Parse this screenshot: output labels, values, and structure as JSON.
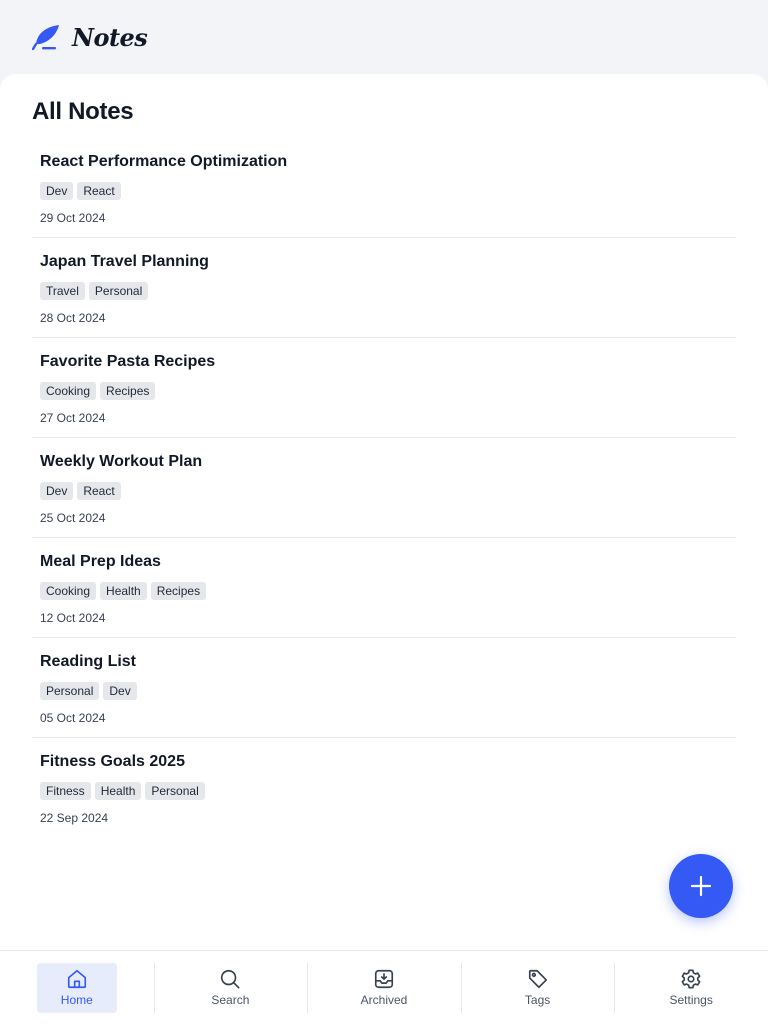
{
  "app": {
    "name": "Notes",
    "logo_icon": "feather-pen-icon",
    "accent_color": "#3559f5"
  },
  "main": {
    "title": "All Notes",
    "notes": [
      {
        "title": "React Performance Optimization",
        "tags": [
          "Dev",
          "React"
        ],
        "date": "29 Oct 2024"
      },
      {
        "title": "Japan Travel Planning",
        "tags": [
          "Travel",
          "Personal"
        ],
        "date": "28 Oct 2024"
      },
      {
        "title": "Favorite Pasta Recipes",
        "tags": [
          "Cooking",
          "Recipes"
        ],
        "date": "27 Oct 2024"
      },
      {
        "title": "Weekly Workout Plan",
        "tags": [
          "Dev",
          "React"
        ],
        "date": "25 Oct 2024"
      },
      {
        "title": "Meal Prep Ideas",
        "tags": [
          "Cooking",
          "Health",
          "Recipes"
        ],
        "date": "12 Oct 2024"
      },
      {
        "title": "Reading List",
        "tags": [
          "Personal",
          "Dev"
        ],
        "date": "05 Oct 2024"
      },
      {
        "title": "Fitness Goals 2025",
        "tags": [
          "Fitness",
          "Health",
          "Personal"
        ],
        "date": "22 Sep 2024"
      }
    ]
  },
  "fab": {
    "icon": "plus-icon"
  },
  "bottom_nav": {
    "items": [
      {
        "label": "Home",
        "icon": "home-icon",
        "active": true
      },
      {
        "label": "Search",
        "icon": "search-icon",
        "active": false
      },
      {
        "label": "Archived",
        "icon": "archive-icon",
        "active": false
      },
      {
        "label": "Tags",
        "icon": "tag-icon",
        "active": false
      },
      {
        "label": "Settings",
        "icon": "gear-icon",
        "active": false
      }
    ]
  }
}
